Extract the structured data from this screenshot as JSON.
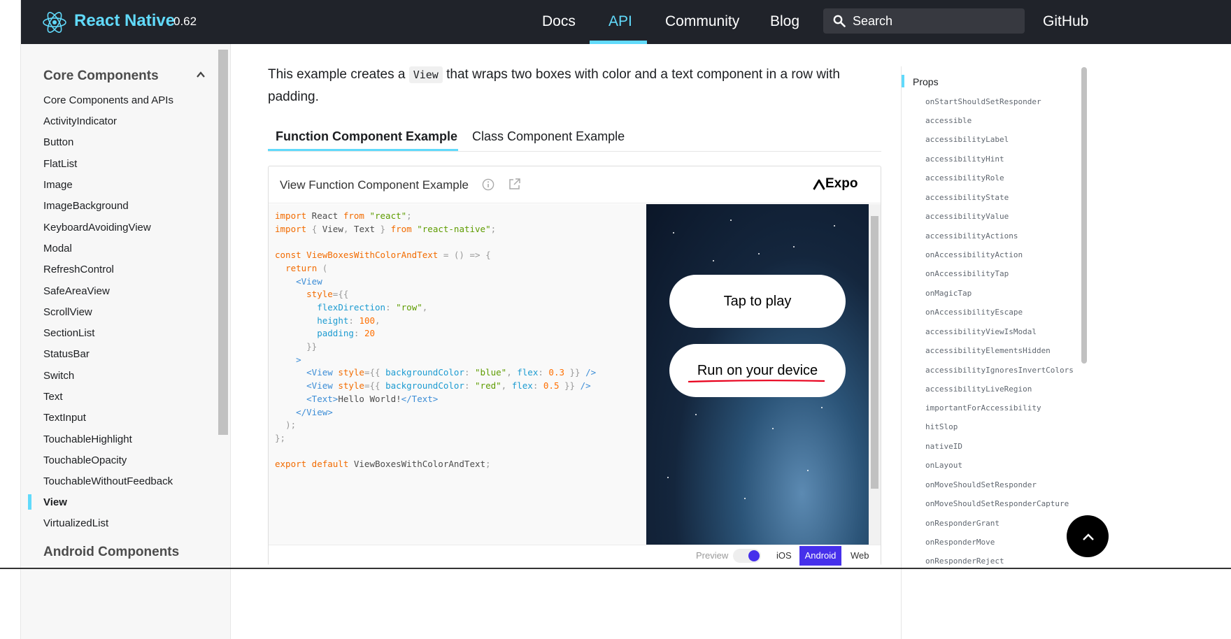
{
  "header": {
    "brand": "React Native",
    "version": "0.62",
    "nav": [
      "Docs",
      "API",
      "Community",
      "Blog"
    ],
    "active_nav": "API",
    "search_label": "Search",
    "github": "GitHub"
  },
  "sidebar": {
    "section_core": "Core Components",
    "items": [
      "Core Components and APIs",
      "ActivityIndicator",
      "Button",
      "FlatList",
      "Image",
      "ImageBackground",
      "KeyboardAvoidingView",
      "Modal",
      "RefreshControl",
      "SafeAreaView",
      "ScrollView",
      "SectionList",
      "StatusBar",
      "Switch",
      "Text",
      "TextInput",
      "TouchableHighlight",
      "TouchableOpacity",
      "TouchableWithoutFeedback",
      "View",
      "VirtualizedList"
    ],
    "active_item": "View",
    "section_android": "Android Components"
  },
  "main": {
    "intro_before": "This example creates a ",
    "intro_code": "View",
    "intro_after": " that wraps two boxes with color and a text component in a row with padding.",
    "tabs": [
      "Function Component Example",
      "Class Component Example"
    ],
    "active_tab": "Function Component Example"
  },
  "snack": {
    "title": "View Function Component Example",
    "expo": "Expo",
    "tap_to_play": "Tap to play",
    "run_on_device": "Run on your device",
    "footer": {
      "preview": "Preview",
      "ios": "iOS",
      "android": "Android",
      "web": "Web"
    },
    "preview_enabled": true,
    "selected_platform": "Android"
  },
  "toc": {
    "heading": "Props",
    "items": [
      "onStartShouldSetResponder",
      "accessible",
      "accessibilityLabel",
      "accessibilityHint",
      "accessibilityRole",
      "accessibilityState",
      "accessibilityValue",
      "accessibilityActions",
      "onAccessibilityAction",
      "onAccessibilityTap",
      "onMagicTap",
      "onAccessibilityEscape",
      "accessibilityViewIsModal",
      "accessibilityElementsHidden",
      "accessibilityIgnoresInvertColors",
      "accessibilityLiveRegion",
      "importantForAccessibility",
      "hitSlop",
      "nativeID",
      "onLayout",
      "onMoveShouldSetResponder",
      "onMoveShouldSetResponderCapture",
      "onResponderGrant",
      "onResponderMove",
      "onResponderReject"
    ]
  },
  "colors": {
    "accent": "#61dafb",
    "header_bg": "#20232a",
    "expo_purple": "#4630eb"
  }
}
